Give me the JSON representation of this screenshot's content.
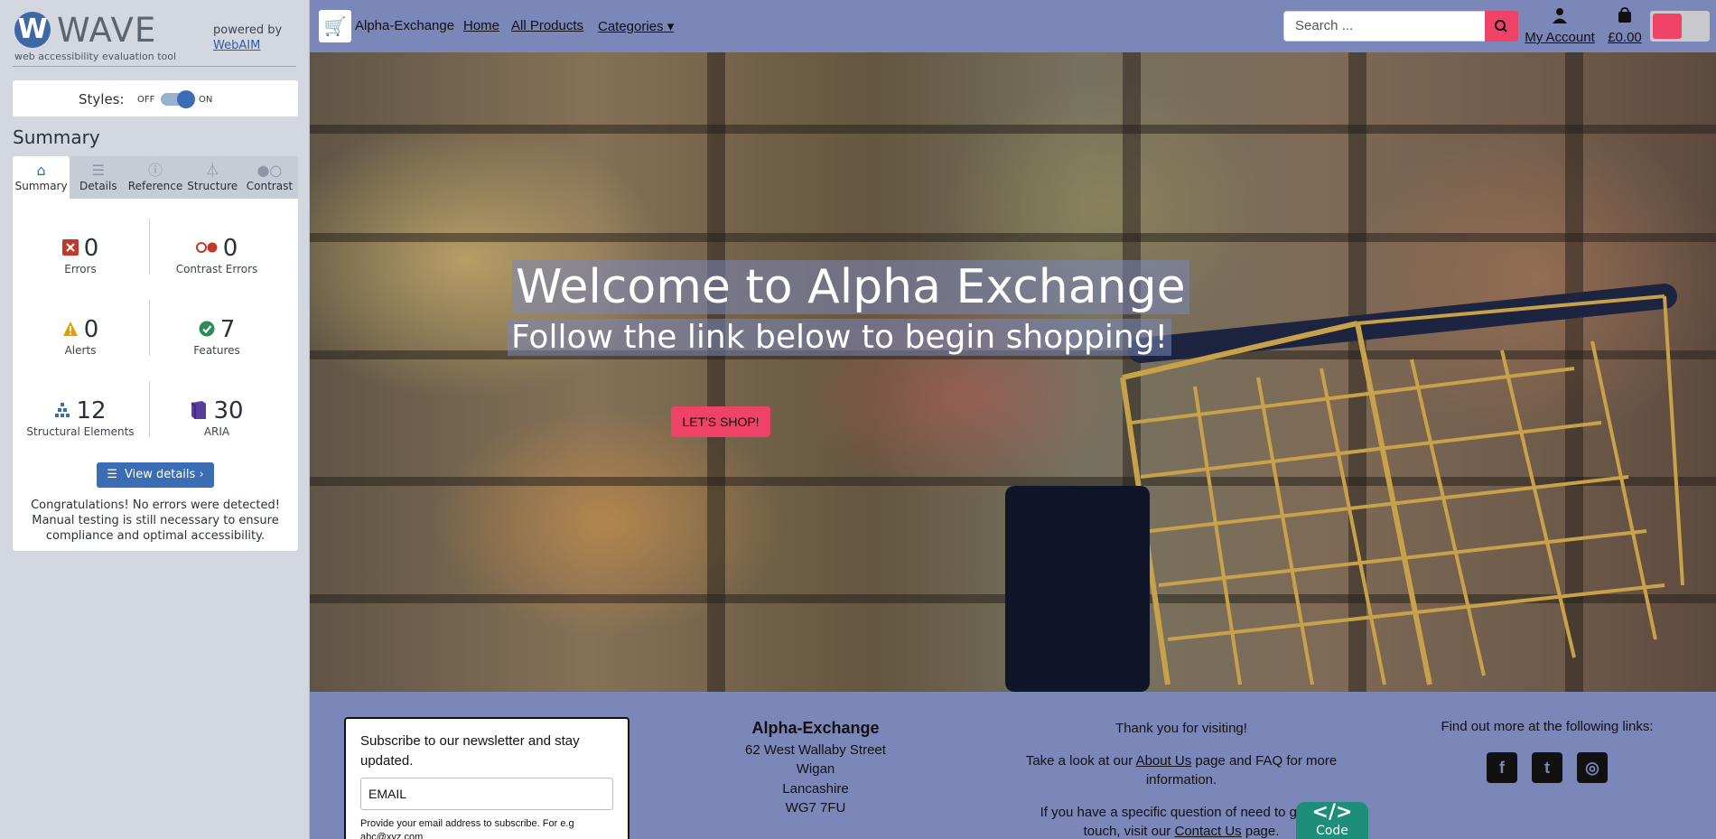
{
  "wave": {
    "logo_letter": "W",
    "logo_text": "WAVE",
    "subtitle": "web accessibility evaluation tool",
    "powered_by": "powered by",
    "webaim_link": "WebAIM",
    "styles_label": "Styles:",
    "styles_off": "OFF",
    "styles_on": "ON",
    "styles_enabled": true,
    "summary_title": "Summary",
    "tabs": [
      {
        "label": "Summary",
        "icon": "home-icon",
        "active": true
      },
      {
        "label": "Details",
        "icon": "list-icon",
        "active": false
      },
      {
        "label": "Reference",
        "icon": "info-icon",
        "active": false
      },
      {
        "label": "Structure",
        "icon": "structure-icon",
        "active": false
      },
      {
        "label": "Contrast",
        "icon": "contrast-icon",
        "active": false
      }
    ],
    "stats": {
      "errors": {
        "value": "0",
        "label": "Errors",
        "color": "#c0392b"
      },
      "contrast_errors": {
        "value": "0",
        "label": "Contrast Errors",
        "color": "#c0392b"
      },
      "alerts": {
        "value": "0",
        "label": "Alerts",
        "color": "#e0a100"
      },
      "features": {
        "value": "7",
        "label": "Features",
        "color": "#2e8b57"
      },
      "structural": {
        "value": "12",
        "label": "Structural Elements",
        "color": "#3b6db4"
      },
      "aria": {
        "value": "30",
        "label": "ARIA",
        "color": "#5b3d9c"
      }
    },
    "view_details": "View details ›",
    "congrats": "Congratulations! No errors were detected! Manual testing is still necessary to ensure compliance and optimal accessibility."
  },
  "site": {
    "brand": "Alpha-Exchange",
    "nav": {
      "home": "Home",
      "all_products": "All Products",
      "categories": "Categories ▾"
    },
    "search_placeholder": "Search ...",
    "account": "My Account",
    "cart_total": "£0.00",
    "accent": "#ee4266",
    "nav_bg": "#7b86b9",
    "hero_title": "Welcome to Alpha Exchange",
    "hero_subtitle": "Follow the link below to begin shopping!",
    "shop_button": "LET'S SHOP!",
    "footer": {
      "newsletter_text": "Subscribe to our newsletter and stay updated.",
      "newsletter_input": "EMAIL",
      "newsletter_help": "Provide your email address to subscribe. For e.g abc@xyz.com",
      "address_name": "Alpha-Exchange",
      "address_lines": [
        "62 West Wallaby Street",
        "Wigan",
        "Lancashire",
        "WG7 7FU"
      ],
      "thanks": "Thank you for visiting!",
      "about_pre": "Take a look at our ",
      "about_link": "About Us",
      "about_post": " page and FAQ for more information.",
      "contact_pre": "If you have a specific question of need to get in touch, visit our ",
      "contact_link": "Contact Us",
      "contact_post": " page.",
      "links_title": "Find out more at the following links:",
      "social": [
        "facebook-icon",
        "twitter-icon",
        "instagram-icon"
      ]
    },
    "code_tab": "Code",
    "code_symbol": "</>"
  }
}
